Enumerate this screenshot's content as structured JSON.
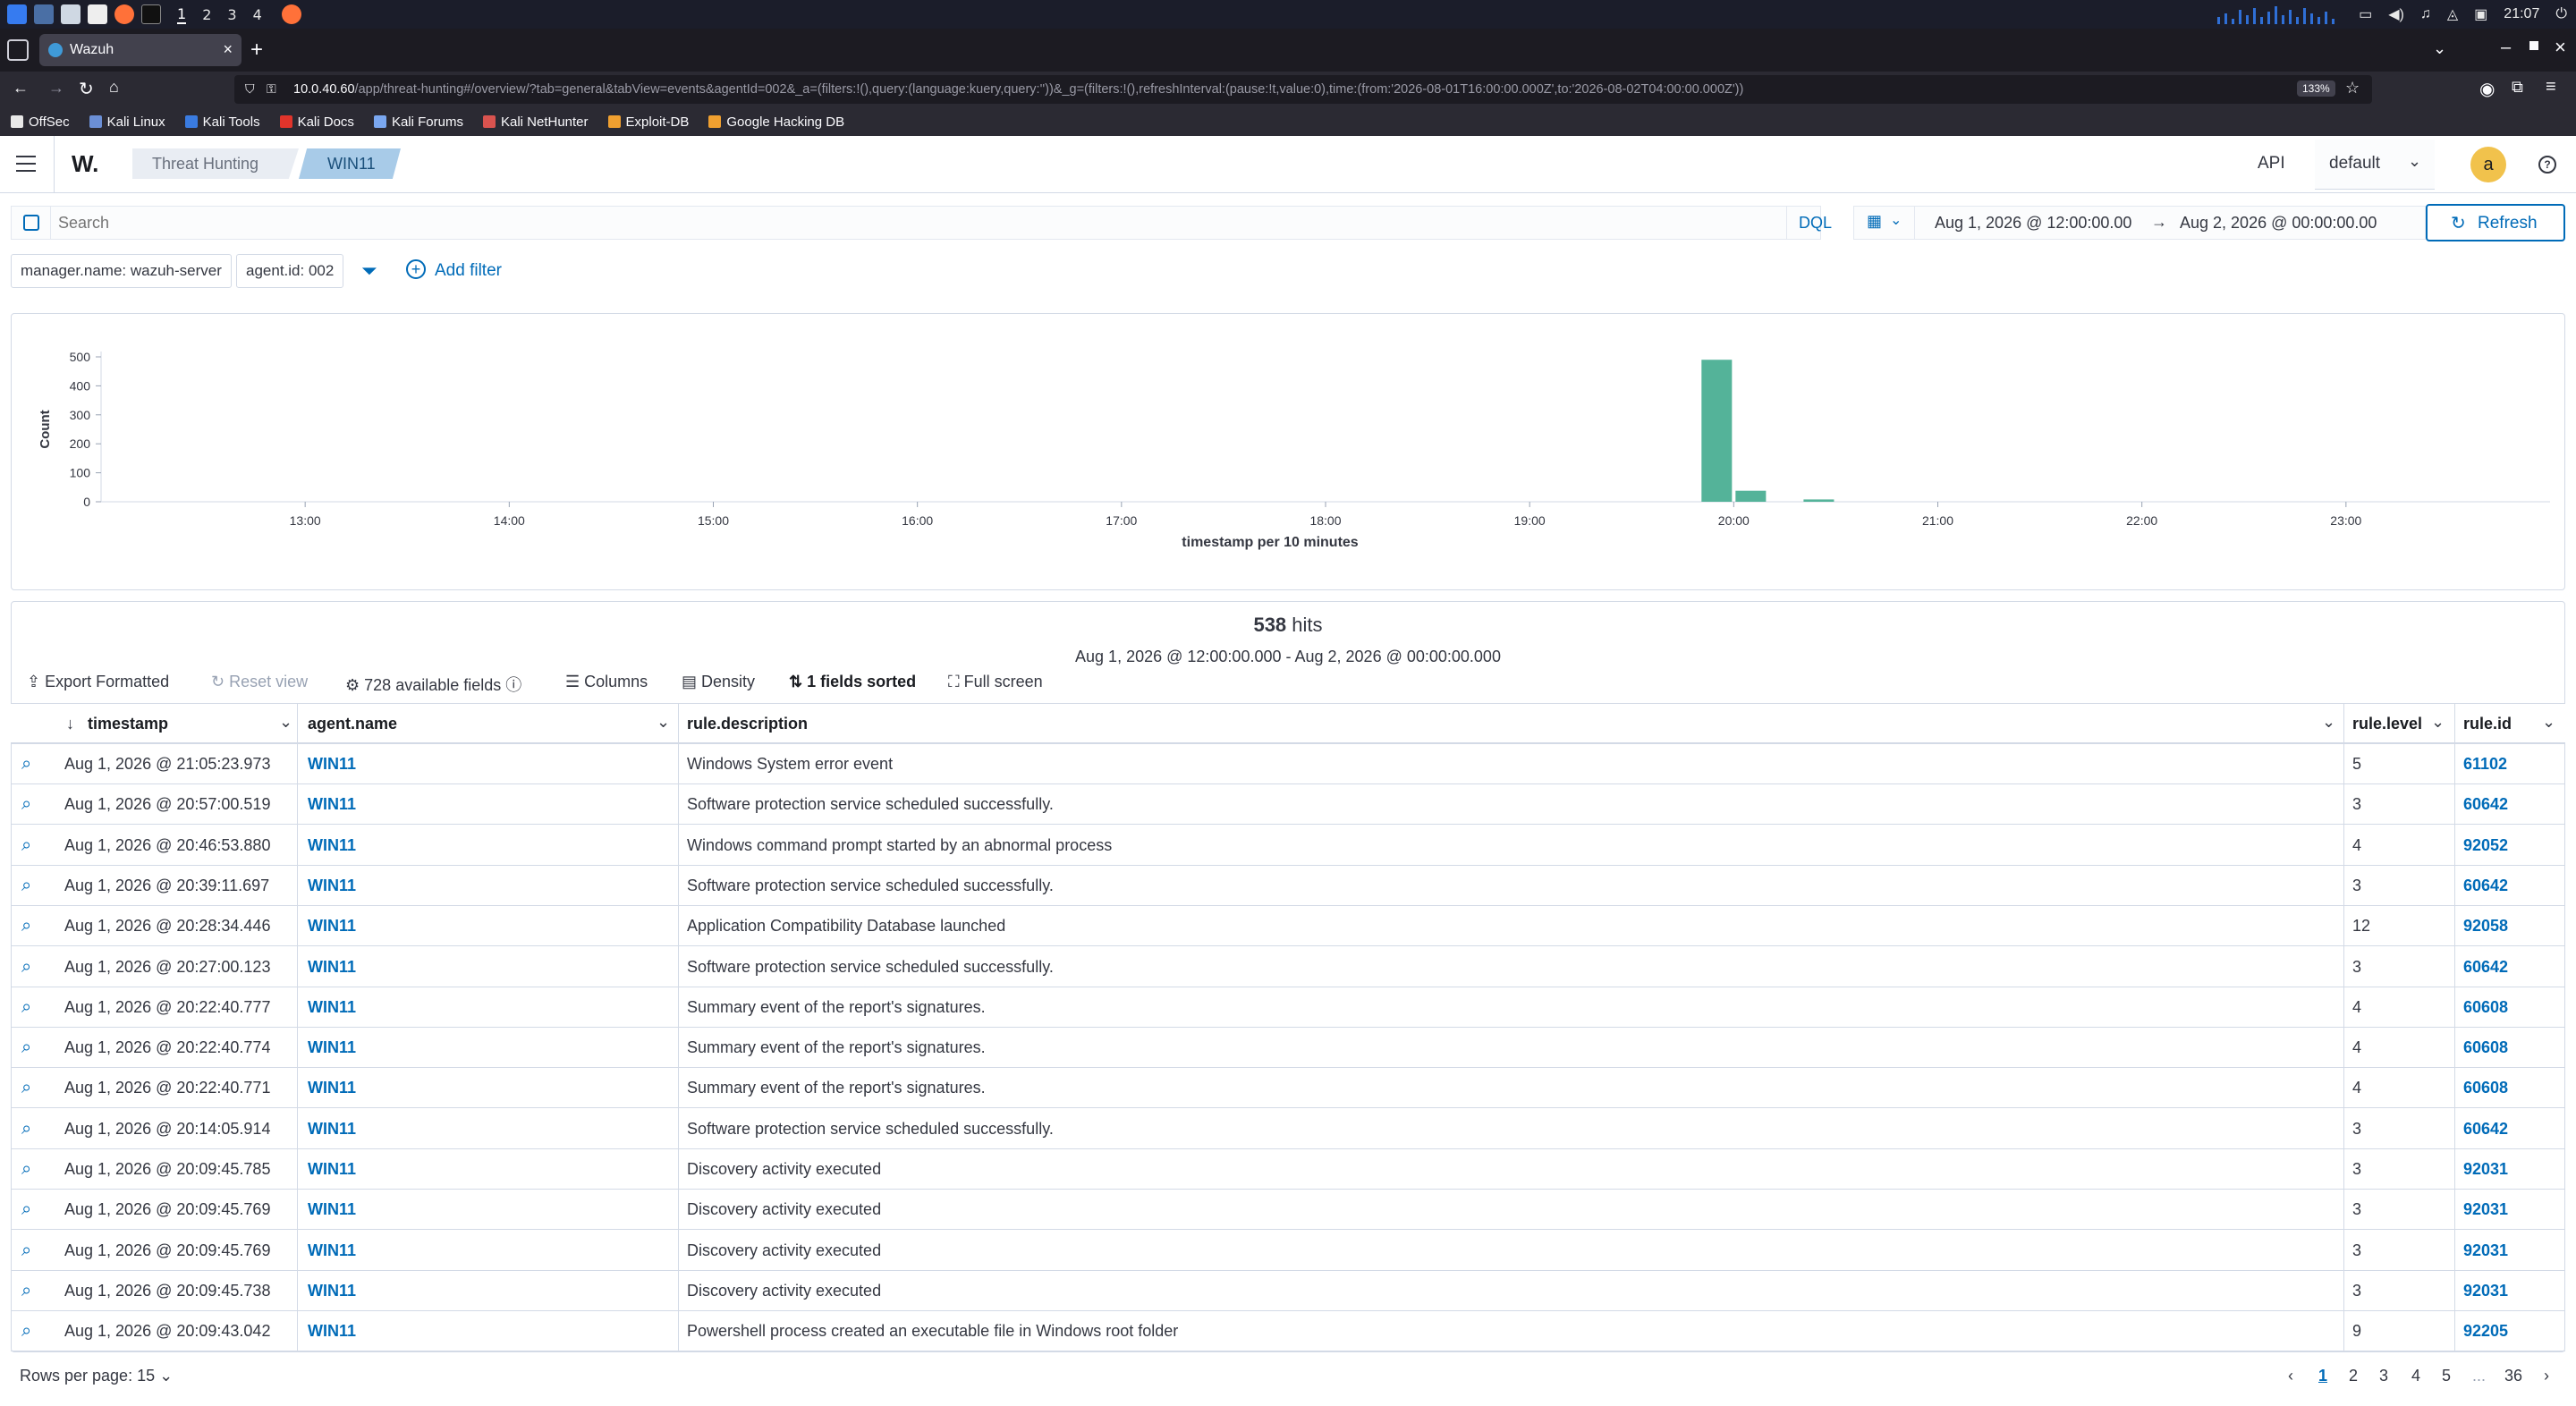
{
  "os": {
    "workspaces": [
      "1",
      "2",
      "3",
      "4"
    ],
    "clock": "21:07"
  },
  "browser": {
    "tab_title": "Wazuh",
    "url_host": "10.0.40.60",
    "url_path": "/app/threat-hunting#/overview/?tab=general&tabView=events&agentId=002&_a=(filters:!(),query:(language:kuery,query:''))&_g=(filters:!(),refreshInterval:(pause:!t,value:0),time:(from:'2026-08-01T16:00:00.000Z',to:'2026-08-02T04:00:00.000Z'))",
    "zoom": "133%",
    "bookmarks": [
      "OffSec",
      "Kali Linux",
      "Kali Tools",
      "Kali Docs",
      "Kali Forums",
      "Kali NetHunter",
      "Exploit-DB",
      "Google Hacking DB"
    ]
  },
  "header": {
    "logo": "W.",
    "breadcrumbs": [
      "Threat Hunting",
      "WIN11"
    ],
    "api_label": "API",
    "api_select": "default",
    "avatar_letter": "a"
  },
  "search": {
    "placeholder": "Search",
    "dql": "DQL",
    "date_from": "Aug 1, 2026 @ 12:00:00.00",
    "arrow": "→",
    "date_to": "Aug 2, 2026 @ 00:00:00.00",
    "refresh": "Refresh"
  },
  "filters": {
    "pills": [
      "manager.name: wazuh-server",
      "agent.id: 002"
    ],
    "add_filter": "Add filter"
  },
  "chart_data": {
    "type": "bar",
    "ylabel": "Count",
    "xlabel": "timestamp per 10 minutes",
    "ylim": [
      0,
      500
    ],
    "yticks": [
      "500",
      "400",
      "300",
      "200",
      "100",
      "0"
    ],
    "xticks": [
      "13:00",
      "14:00",
      "15:00",
      "16:00",
      "17:00",
      "18:00",
      "19:00",
      "20:00",
      "21:00",
      "22:00",
      "23:00"
    ],
    "categories": [
      "19:50",
      "20:00",
      "20:20"
    ],
    "values": [
      490,
      38,
      8
    ],
    "color": "#54b399"
  },
  "results": {
    "hits_count": "538",
    "hits_label": "hits",
    "range": "Aug 1, 2026 @ 12:00:00.000 - Aug 2, 2026 @ 00:00:00.000",
    "toolbar": {
      "export": "Export Formatted",
      "reset": "Reset view",
      "fields": "728 available fields",
      "columns": "Columns",
      "density": "Density",
      "sorted": "1 fields sorted",
      "fullscreen": "Full screen"
    },
    "columns": [
      "timestamp",
      "agent.name",
      "rule.description",
      "rule.level",
      "rule.id"
    ],
    "rows": [
      {
        "timestamp": "Aug 1, 2026 @ 21:05:23.973",
        "agent": "WIN11",
        "description": "Windows System error event",
        "level": "5",
        "id": "61102"
      },
      {
        "timestamp": "Aug 1, 2026 @ 20:57:00.519",
        "agent": "WIN11",
        "description": "Software protection service scheduled successfully.",
        "level": "3",
        "id": "60642"
      },
      {
        "timestamp": "Aug 1, 2026 @ 20:46:53.880",
        "agent": "WIN11",
        "description": "Windows command prompt started by an abnormal process",
        "level": "4",
        "id": "92052"
      },
      {
        "timestamp": "Aug 1, 2026 @ 20:39:11.697",
        "agent": "WIN11",
        "description": "Software protection service scheduled successfully.",
        "level": "3",
        "id": "60642"
      },
      {
        "timestamp": "Aug 1, 2026 @ 20:28:34.446",
        "agent": "WIN11",
        "description": "Application Compatibility Database launched",
        "level": "12",
        "id": "92058"
      },
      {
        "timestamp": "Aug 1, 2026 @ 20:27:00.123",
        "agent": "WIN11",
        "description": "Software protection service scheduled successfully.",
        "level": "3",
        "id": "60642"
      },
      {
        "timestamp": "Aug 1, 2026 @ 20:22:40.777",
        "agent": "WIN11",
        "description": "Summary event of the report's signatures.",
        "level": "4",
        "id": "60608"
      },
      {
        "timestamp": "Aug 1, 2026 @ 20:22:40.774",
        "agent": "WIN11",
        "description": "Summary event of the report's signatures.",
        "level": "4",
        "id": "60608"
      },
      {
        "timestamp": "Aug 1, 2026 @ 20:22:40.771",
        "agent": "WIN11",
        "description": "Summary event of the report's signatures.",
        "level": "4",
        "id": "60608"
      },
      {
        "timestamp": "Aug 1, 2026 @ 20:14:05.914",
        "agent": "WIN11",
        "description": "Software protection service scheduled successfully.",
        "level": "3",
        "id": "60642"
      },
      {
        "timestamp": "Aug 1, 2026 @ 20:09:45.785",
        "agent": "WIN11",
        "description": "Discovery activity executed",
        "level": "3",
        "id": "92031"
      },
      {
        "timestamp": "Aug 1, 2026 @ 20:09:45.769",
        "agent": "WIN11",
        "description": "Discovery activity executed",
        "level": "3",
        "id": "92031"
      },
      {
        "timestamp": "Aug 1, 2026 @ 20:09:45.769",
        "agent": "WIN11",
        "description": "Discovery activity executed",
        "level": "3",
        "id": "92031"
      },
      {
        "timestamp": "Aug 1, 2026 @ 20:09:45.738",
        "agent": "WIN11",
        "description": "Discovery activity executed",
        "level": "3",
        "id": "92031"
      },
      {
        "timestamp": "Aug 1, 2026 @ 20:09:43.042",
        "agent": "WIN11",
        "description": "Powershell process created an executable file in Windows root folder",
        "level": "9",
        "id": "92205"
      }
    ],
    "rows_per_page": "Rows per page: 15",
    "pages": [
      "1",
      "2",
      "3",
      "4",
      "5",
      "...",
      "36"
    ]
  }
}
